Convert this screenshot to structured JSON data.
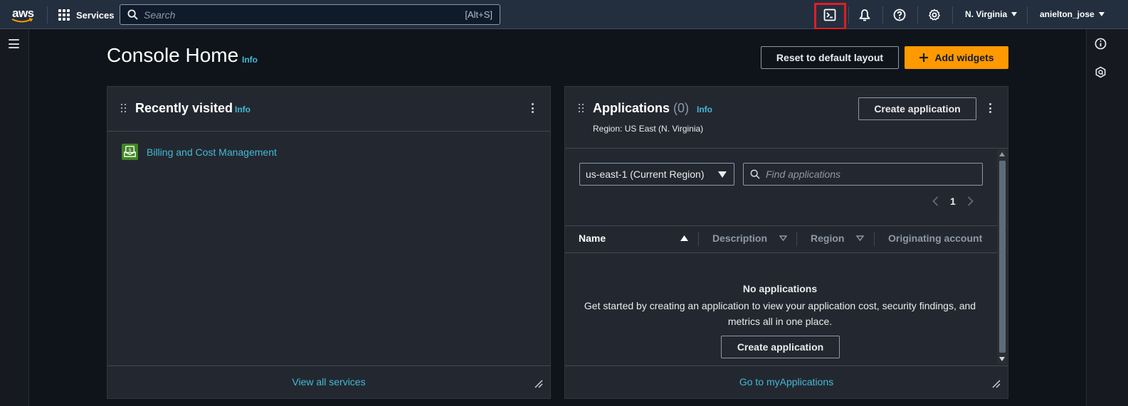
{
  "topnav": {
    "logo_text": "aws",
    "services_label": "Services",
    "search_placeholder": "Search",
    "search_shortcut": "[Alt+S]",
    "region_label": "N. Virginia",
    "user_label": "anielton_jose",
    "highlight_color": "#e11d24"
  },
  "header": {
    "title": "Console Home",
    "info_label": "Info",
    "reset_label": "Reset to default layout",
    "add_widgets_label": "Add widgets"
  },
  "recently_visited": {
    "title": "Recently visited",
    "info_label": "Info",
    "items": [
      {
        "label": "Billing and Cost Management",
        "icon": "billing-icon"
      }
    ],
    "footer_link": "View all services"
  },
  "applications": {
    "title": "Applications",
    "count": "(0)",
    "info_label": "Info",
    "region_note": "Region: US East (N. Virginia)",
    "create_label": "Create application",
    "region_select": "us-east-1 (Current Region)",
    "find_placeholder": "Find applications",
    "page_number": "1",
    "columns": [
      "Name",
      "Description",
      "Region",
      "Originating account"
    ],
    "empty_title": "No applications",
    "empty_text_1": "Get started by creating an application to view your application cost, security findings, and",
    "empty_text_2": "metrics all in one place.",
    "empty_create_label": "Create application",
    "footer_link": "Go to myApplications"
  },
  "colors": {
    "accent_orange": "#ff9900",
    "link_blue": "#44b9d6",
    "nav_bg": "#232f3e"
  }
}
